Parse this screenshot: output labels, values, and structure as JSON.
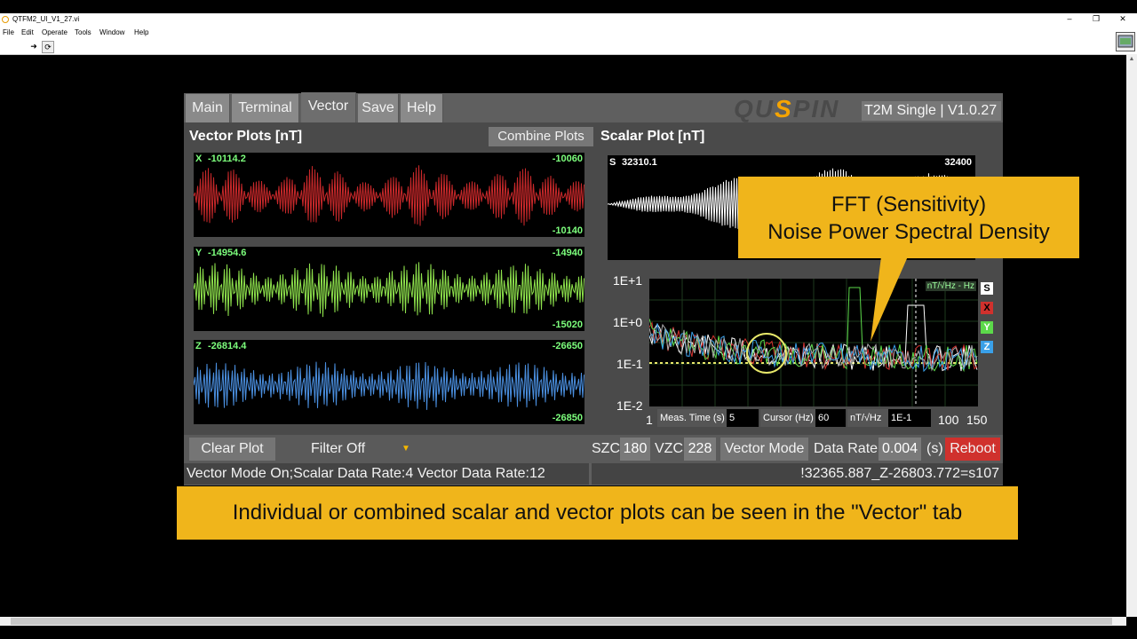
{
  "window": {
    "title": "QTFM2_UI_V1_27.vi",
    "menu": [
      "File",
      "Edit",
      "Operate",
      "Tools",
      "Window",
      "Help"
    ]
  },
  "app": {
    "tabs": [
      "Main",
      "Terminal",
      "Vector",
      "Save",
      "Help"
    ],
    "active_tab": "Vector",
    "logo": {
      "q": "QU",
      "s": "S",
      "pin": "PIN"
    },
    "version": "T2M Single | V1.0.27"
  },
  "vector": {
    "title": "Vector Plots [nT]",
    "combine_label": "Combine Plots",
    "plots": [
      {
        "axis": "X",
        "current": "-10114.2",
        "max": "-10060",
        "min": "-10140",
        "color": "#c8282a"
      },
      {
        "axis": "Y",
        "current": "-14954.6",
        "max": "-14940",
        "min": "-15020",
        "color": "#8ee24c"
      },
      {
        "axis": "Z",
        "current": "-26814.4",
        "max": "-26650",
        "min": "-26850",
        "color": "#4a8fe0"
      }
    ]
  },
  "scalar": {
    "title": "Scalar Plot [nT]",
    "label": "S",
    "current": "32310.1",
    "max": "32400"
  },
  "fft": {
    "y_ticks": [
      "1E+1",
      "1E+0",
      "1E-1",
      "1E-2"
    ],
    "x_ticks": [
      "1",
      "100",
      "150"
    ],
    "unit_label": "nT/√Hz - Hz",
    "legend": [
      {
        "key": "S",
        "bg": "#ffffff",
        "fg": "#000000"
      },
      {
        "key": "X",
        "bg": "#d0312d",
        "fg": "#000000"
      },
      {
        "key": "Y",
        "bg": "#5cd94a",
        "fg": "#ffffff"
      },
      {
        "key": "Z",
        "bg": "#3aa0e8",
        "fg": "#ffffff"
      }
    ],
    "meas_time_label": "Meas. Time (s)",
    "meas_time": "5",
    "cursor_label": "Cursor (Hz)",
    "cursor": "60",
    "sens_label": "nT/√Hz",
    "sens": "1E-1"
  },
  "controls": {
    "clear_plot": "Clear Plot",
    "filter": "Filter Off",
    "szc_label": "SZC",
    "szc": "180",
    "vzc_label": "VZC",
    "vzc": "228",
    "vector_mode": "Vector Mode",
    "data_rate_label": "Data Rate",
    "data_rate": "0.004",
    "unit": "(s)",
    "reboot": "Reboot"
  },
  "status": {
    "left": "Vector Mode On;Scalar Data Rate:4 Vector Data Rate:12",
    "right": "!32365.887_Z-26803.772=s107"
  },
  "callouts": {
    "fft_line1": "FFT (Sensitivity)",
    "fft_line2": "Noise Power Spectral Density",
    "bottom": "Individual or combined scalar and vector plots can be seen in the \"Vector\" tab"
  }
}
